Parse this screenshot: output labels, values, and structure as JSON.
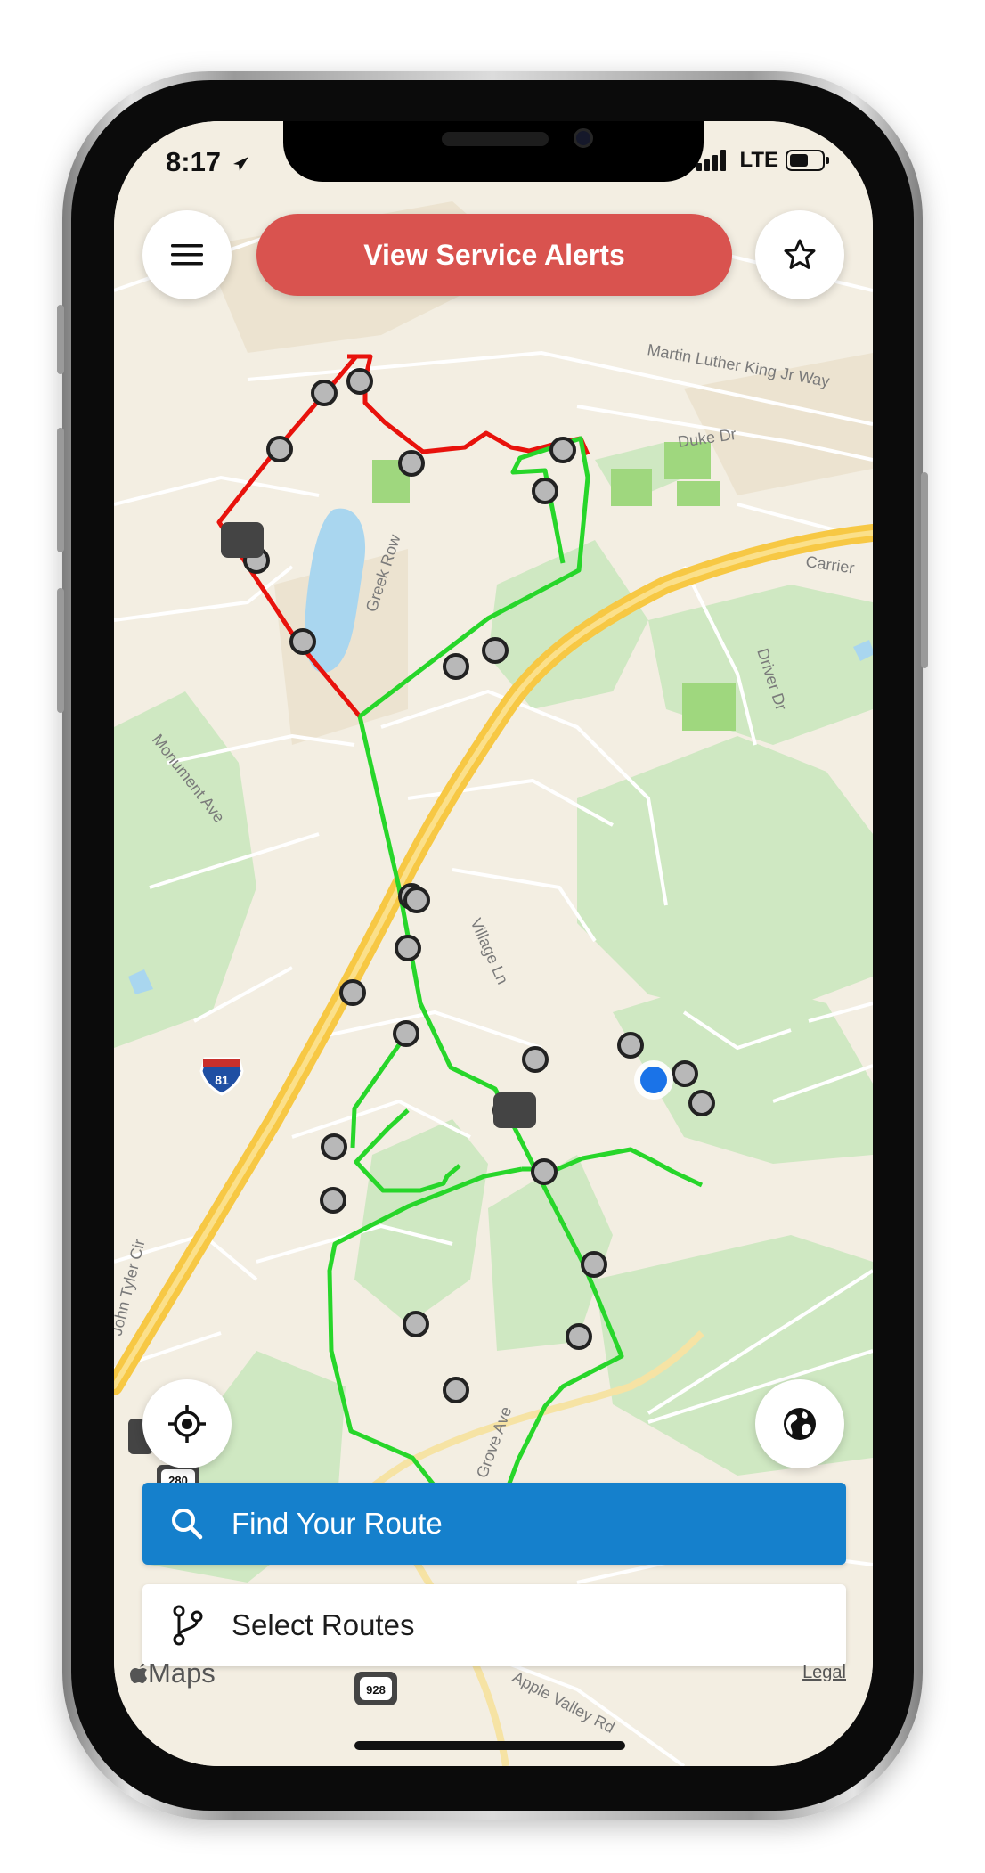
{
  "status_bar": {
    "time": "8:17",
    "network": "LTE"
  },
  "header": {
    "alerts_label": "View Service Alerts"
  },
  "icons": {
    "menu": "menu-icon",
    "favorites": "star-icon",
    "locate": "locate-icon",
    "globe": "globe-icon",
    "search": "search-icon",
    "routes": "branch-icon",
    "location_arrow": "location-arrow-icon"
  },
  "map": {
    "streets": {
      "mlk": "Martin Luther King Jr Way",
      "duke": "Duke Dr",
      "greek_row": "Greek Row",
      "carrier": "Carrier",
      "driver": "Driver Dr",
      "monument": "Monument Ave",
      "village": "Village Ln",
      "grove": "Grove Ave",
      "apple_valley": "Apple Valley Rd",
      "john_tyler": "John Tyler Cir"
    },
    "shields": {
      "interstate": "81",
      "route_928": "928",
      "route_280": "280"
    },
    "colors": {
      "red_route": "#e8120c",
      "green_route": "#27d62a",
      "highway": "#f7c844",
      "user_location": "#1a73e8",
      "alerts_button": "#d9534f",
      "find_bar": "#1580cc"
    }
  },
  "bottom": {
    "find_label": "Find Your Route",
    "select_label": "Select Routes"
  },
  "attribution": {
    "maps": "Maps",
    "legal": "Legal"
  }
}
